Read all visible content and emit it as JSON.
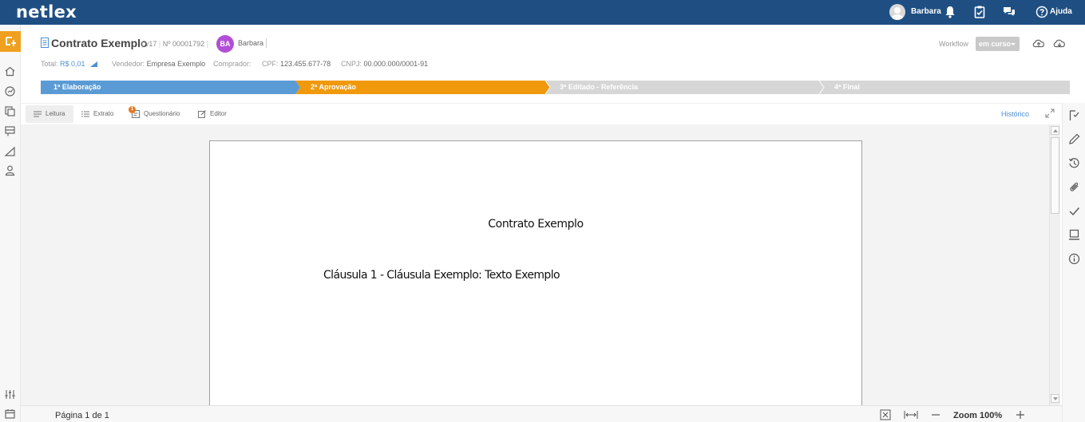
{
  "app": {
    "logo": "netlex"
  },
  "topbar": {
    "user_name": "Barbara",
    "help_label": "Ajuda",
    "icons": [
      "user-avatar",
      "bell-icon",
      "clipboard-check-icon",
      "chat-icon",
      "help-circle-icon"
    ]
  },
  "sidebar": {
    "icons": [
      "contracts-icon",
      "home-icon",
      "dashboard-icon",
      "documents-icon",
      "templates-icon",
      "reports-icon",
      "user-icon",
      "filters-icon",
      "calendar-icon"
    ]
  },
  "header": {
    "title": "Contrato Exemplo",
    "version": "v17",
    "number": "Nº 00001792",
    "avatar_initials": "BA",
    "user_name": "Barbara",
    "workflow_label": "Workflow",
    "workflow_status": "em curso",
    "total_label": "Total:",
    "total_value": "R$ 0,01",
    "vendor_label": "Vendedor:",
    "vendor_value": "Empresa Exemplo",
    "buyer_label": "Comprador:",
    "cpf_label": "CPF:",
    "cpf_value": "123.455.677-78",
    "cnpj_label": "CNPJ:",
    "cnpj_value": "00.000.000/0001-91"
  },
  "stages": [
    {
      "label": "1ª Elaboração",
      "state": "done",
      "color": "#5b9bd5"
    },
    {
      "label": "2ª Aprovação",
      "state": "current",
      "color": "#f0990c"
    },
    {
      "label": "3ª Editado - Referência",
      "state": "pending",
      "color": "#d6d6d6"
    },
    {
      "label": "4ª Final",
      "state": "pending",
      "color": "#d6d6d6"
    }
  ],
  "tabs": [
    {
      "label": "Leitura",
      "active": true
    },
    {
      "label": "Extrato",
      "active": false
    },
    {
      "label": "Questionário",
      "active": false,
      "badge": "1"
    },
    {
      "label": "Editor",
      "active": false
    }
  ],
  "history_label": "Histórico",
  "document": {
    "title": "Contrato Exemplo",
    "clause": "Cláusula 1 - Cláusula Exemplo: Texto Exemplo"
  },
  "rightbar": {
    "icons": [
      "flag-check-icon",
      "pen-icon",
      "history-icon",
      "paperclip-icon",
      "check-icon",
      "monitor-icon",
      "info-icon"
    ]
  },
  "footer": {
    "page_info": "Página 1 de 1",
    "zoom_label": "Zoom 100%"
  }
}
